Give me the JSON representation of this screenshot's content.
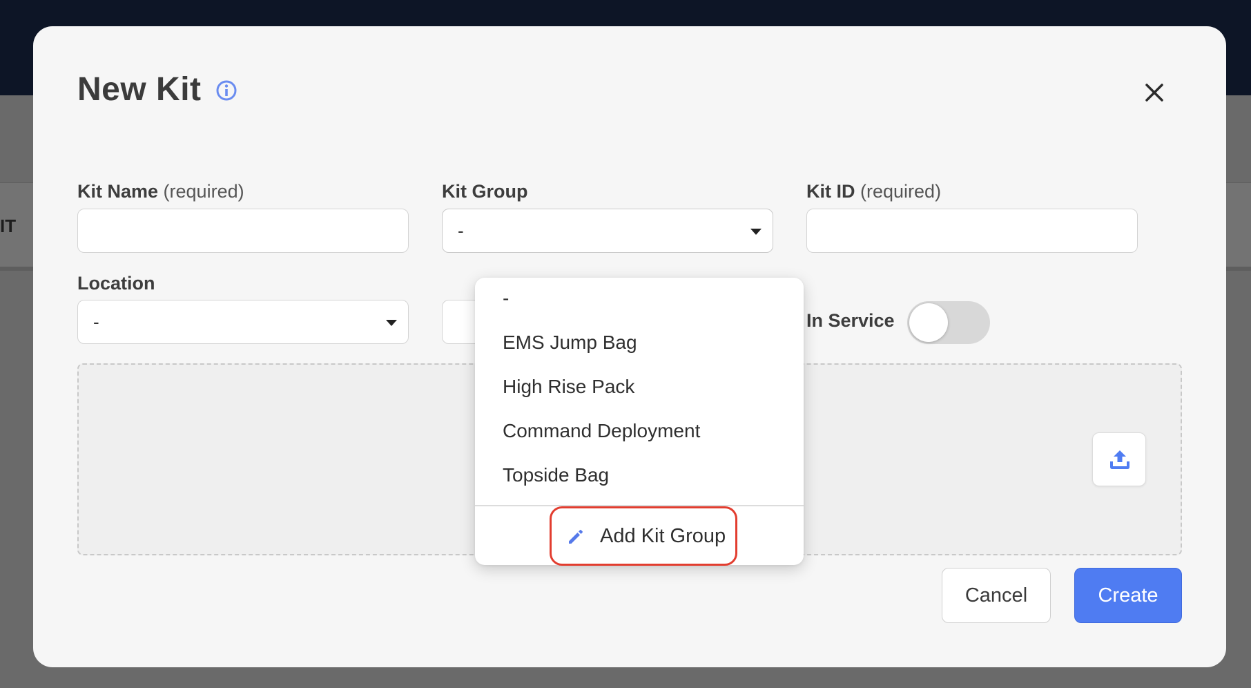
{
  "background": {
    "partial_text": "IT"
  },
  "modal": {
    "title": "New Kit",
    "fields": {
      "kit_name": {
        "label": "Kit Name",
        "hint": "(required)",
        "value": ""
      },
      "kit_group": {
        "label": "Kit Group",
        "value": "-"
      },
      "kit_id": {
        "label": "Kit ID",
        "hint": "(required)",
        "value": ""
      },
      "location": {
        "label": "Location",
        "value": "-"
      }
    },
    "in_service": {
      "label": "In Service",
      "checked": false
    },
    "kit_group_dropdown": {
      "options": [
        "-",
        "EMS Jump Bag",
        "High Rise Pack",
        "Command Deployment",
        "Topside Bag"
      ],
      "add_label": "Add Kit Group"
    },
    "buttons": {
      "cancel": "Cancel",
      "create": "Create"
    }
  },
  "colors": {
    "primary": "#4f7cf2",
    "highlight": "#e23d2f",
    "header_bg": "#0d1526"
  },
  "icons": {
    "info": "info-icon",
    "close": "close-icon",
    "upload": "upload-icon",
    "edit": "pencil-icon"
  }
}
